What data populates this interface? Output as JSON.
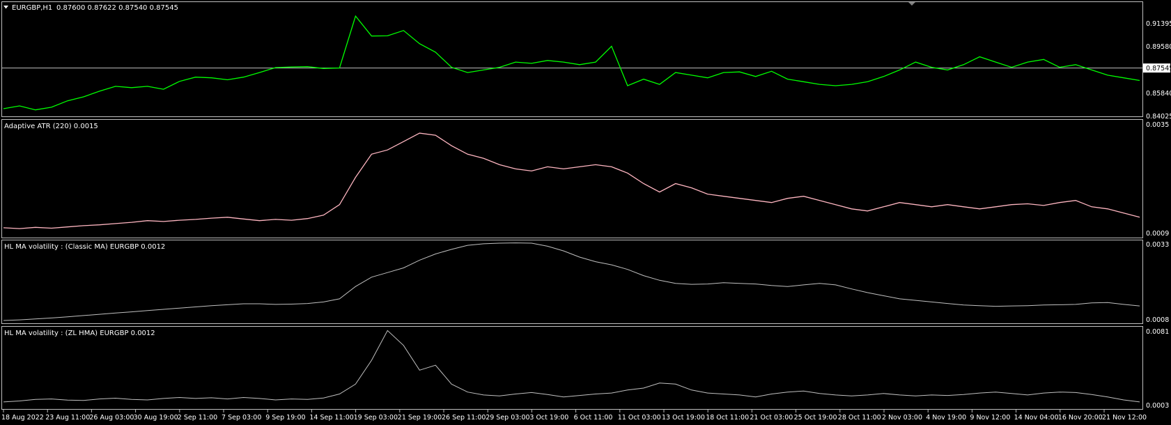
{
  "window": {
    "symbol_label": "EURGBP,H1",
    "ohlc_label": "0.87600 0.87622 0.87540 0.87545"
  },
  "colors": {
    "background": "#000000",
    "frame": "#C0C0C0",
    "price_line": "#00FF00",
    "atr_line": "#FFB6C1",
    "volatility_line": "#C0C0C0",
    "current_price_line": "#C0C0C0"
  },
  "chart_data": [
    {
      "type": "line",
      "title": "EURGBP,H1  0.87600 0.87622 0.87540 0.87545",
      "series": [
        {
          "name": "",
          "values": [
            0.8445,
            0.8466,
            0.8436,
            0.8456,
            0.8505,
            0.8535,
            0.8578,
            0.8615,
            0.8605,
            0.8615,
            0.8593,
            0.8653,
            0.8685,
            0.868,
            0.8665,
            0.8685,
            0.872,
            0.8758,
            0.8762,
            0.8765,
            0.8751,
            0.8755,
            0.915,
            0.8998,
            0.9,
            0.904,
            0.894,
            0.8875,
            0.876,
            0.872,
            0.874,
            0.876,
            0.88,
            0.879,
            0.8812,
            0.88,
            0.878,
            0.88,
            0.892,
            0.862,
            0.867,
            0.863,
            0.872,
            0.87,
            0.868,
            0.872,
            0.8725,
            0.869,
            0.873,
            0.867,
            0.865,
            0.863,
            0.862,
            0.863,
            0.865,
            0.869,
            0.874,
            0.88,
            0.876,
            0.874,
            0.878,
            0.884,
            0.88,
            0.876,
            0.88,
            0.882,
            0.876,
            0.878,
            0.874,
            0.87,
            0.868,
            0.866
          ]
        }
      ],
      "yticks": [
        "0.91395",
        "0.89580",
        "0.85840",
        "0.84025"
      ],
      "current_price": "0.87545",
      "current_value": 0.87545,
      "ylim": [
        0.84025,
        0.923
      ]
    },
    {
      "type": "line",
      "title": "Adaptive ATR (220) 0.0015",
      "series": [
        {
          "name": "",
          "values": [
            0.00105,
            0.00103,
            0.00106,
            0.00104,
            0.00107,
            0.0011,
            0.00112,
            0.00115,
            0.00118,
            0.00122,
            0.0012,
            0.00123,
            0.00125,
            0.00128,
            0.0013,
            0.00126,
            0.00122,
            0.00125,
            0.00123,
            0.00127,
            0.00135,
            0.0016,
            0.00225,
            0.0028,
            0.0029,
            0.0031,
            0.0033,
            0.00325,
            0.003,
            0.0028,
            0.0027,
            0.00255,
            0.00245,
            0.0024,
            0.0025,
            0.00245,
            0.0025,
            0.00255,
            0.0025,
            0.00235,
            0.0021,
            0.0019,
            0.0021,
            0.002,
            0.00185,
            0.0018,
            0.00175,
            0.0017,
            0.00165,
            0.00175,
            0.0018,
            0.0017,
            0.0016,
            0.0015,
            0.00145,
            0.00155,
            0.00165,
            0.0016,
            0.00155,
            0.0016,
            0.00155,
            0.0015,
            0.00155,
            0.0016,
            0.00162,
            0.00158,
            0.00165,
            0.0017,
            0.00155,
            0.0015,
            0.0014,
            0.0013
          ]
        }
      ],
      "yticks": [
        "0.0035",
        "0.0009"
      ],
      "ylim": [
        0.0009,
        0.0035
      ]
    },
    {
      "type": "line",
      "title": "HL MA volatility : (Classic MA) EURGBP 0.0012",
      "series": [
        {
          "name": "",
          "values": [
            0.0008,
            0.00082,
            0.00085,
            0.00088,
            0.00092,
            0.00096,
            0.001,
            0.00104,
            0.00108,
            0.00112,
            0.00116,
            0.0012,
            0.00124,
            0.00128,
            0.00131,
            0.00134,
            0.00134,
            0.00132,
            0.00133,
            0.00135,
            0.0014,
            0.0015,
            0.0019,
            0.0022,
            0.00235,
            0.0025,
            0.00275,
            0.00295,
            0.0031,
            0.00323,
            0.00328,
            0.0033,
            0.00331,
            0.0033,
            0.0032,
            0.00305,
            0.00285,
            0.0027,
            0.0026,
            0.00245,
            0.00225,
            0.0021,
            0.002,
            0.00197,
            0.00198,
            0.00202,
            0.002,
            0.00198,
            0.00193,
            0.0019,
            0.00195,
            0.002,
            0.00195,
            0.00182,
            0.0017,
            0.0016,
            0.0015,
            0.00145,
            0.0014,
            0.00135,
            0.0013,
            0.00128,
            0.00126,
            0.00127,
            0.00128,
            0.0013,
            0.00131,
            0.00132,
            0.00137,
            0.00138,
            0.00132,
            0.00127
          ]
        }
      ],
      "yticks": [
        "0.0033",
        "0.0008"
      ],
      "ylim": [
        0.0008,
        0.0033
      ]
    },
    {
      "type": "line",
      "title": "HL MA volatility : (ZL HMA) EURGBP 0.0012",
      "series": [
        {
          "name": "",
          "values": [
            0.0008,
            0.0009,
            0.00105,
            0.0011,
            0.00098,
            0.00095,
            0.0011,
            0.00118,
            0.00105,
            0.001,
            0.00115,
            0.00125,
            0.00115,
            0.00122,
            0.0011,
            0.00125,
            0.00115,
            0.001,
            0.0011,
            0.00105,
            0.0012,
            0.0016,
            0.0026,
            0.005,
            0.008,
            0.0065,
            0.004,
            0.0045,
            0.0026,
            0.0018,
            0.0015,
            0.0014,
            0.0016,
            0.00175,
            0.00155,
            0.0013,
            0.00145,
            0.0016,
            0.0017,
            0.002,
            0.0022,
            0.0027,
            0.0026,
            0.002,
            0.0017,
            0.0016,
            0.0015,
            0.0013,
            0.0016,
            0.0018,
            0.0019,
            0.00165,
            0.0015,
            0.0014,
            0.0015,
            0.00165,
            0.0015,
            0.0014,
            0.0015,
            0.00145,
            0.00155,
            0.0017,
            0.0018,
            0.00165,
            0.0015,
            0.0017,
            0.0018,
            0.00175,
            0.00155,
            0.0013,
            0.001,
            0.0008
          ]
        }
      ],
      "yticks": [
        "0.0081",
        "0.0003"
      ],
      "ylim": [
        0.0003,
        0.0081
      ]
    }
  ],
  "time_axis": {
    "ticks": [
      "18 Aug 2022",
      "23 Aug 11:00",
      "26 Aug 03:00",
      "30 Aug 19:00",
      "2 Sep 11:00",
      "7 Sep 03:00",
      "9 Sep 19:00",
      "14 Sep 11:00",
      "19 Sep 03:00",
      "21 Sep 19:00",
      "26 Sep 11:00",
      "29 Sep 03:00",
      "3 Oct 19:00",
      "6 Oct 11:00",
      "11 Oct 03:00",
      "13 Oct 19:00",
      "18 Oct 11:00",
      "21 Oct 03:00",
      "25 Oct 19:00",
      "28 Oct 11:00",
      "2 Nov 03:00",
      "4 Nov 19:00",
      "9 Nov 12:00",
      "14 Nov 04:00",
      "16 Nov 20:00",
      "21 Nov 12:00"
    ]
  }
}
